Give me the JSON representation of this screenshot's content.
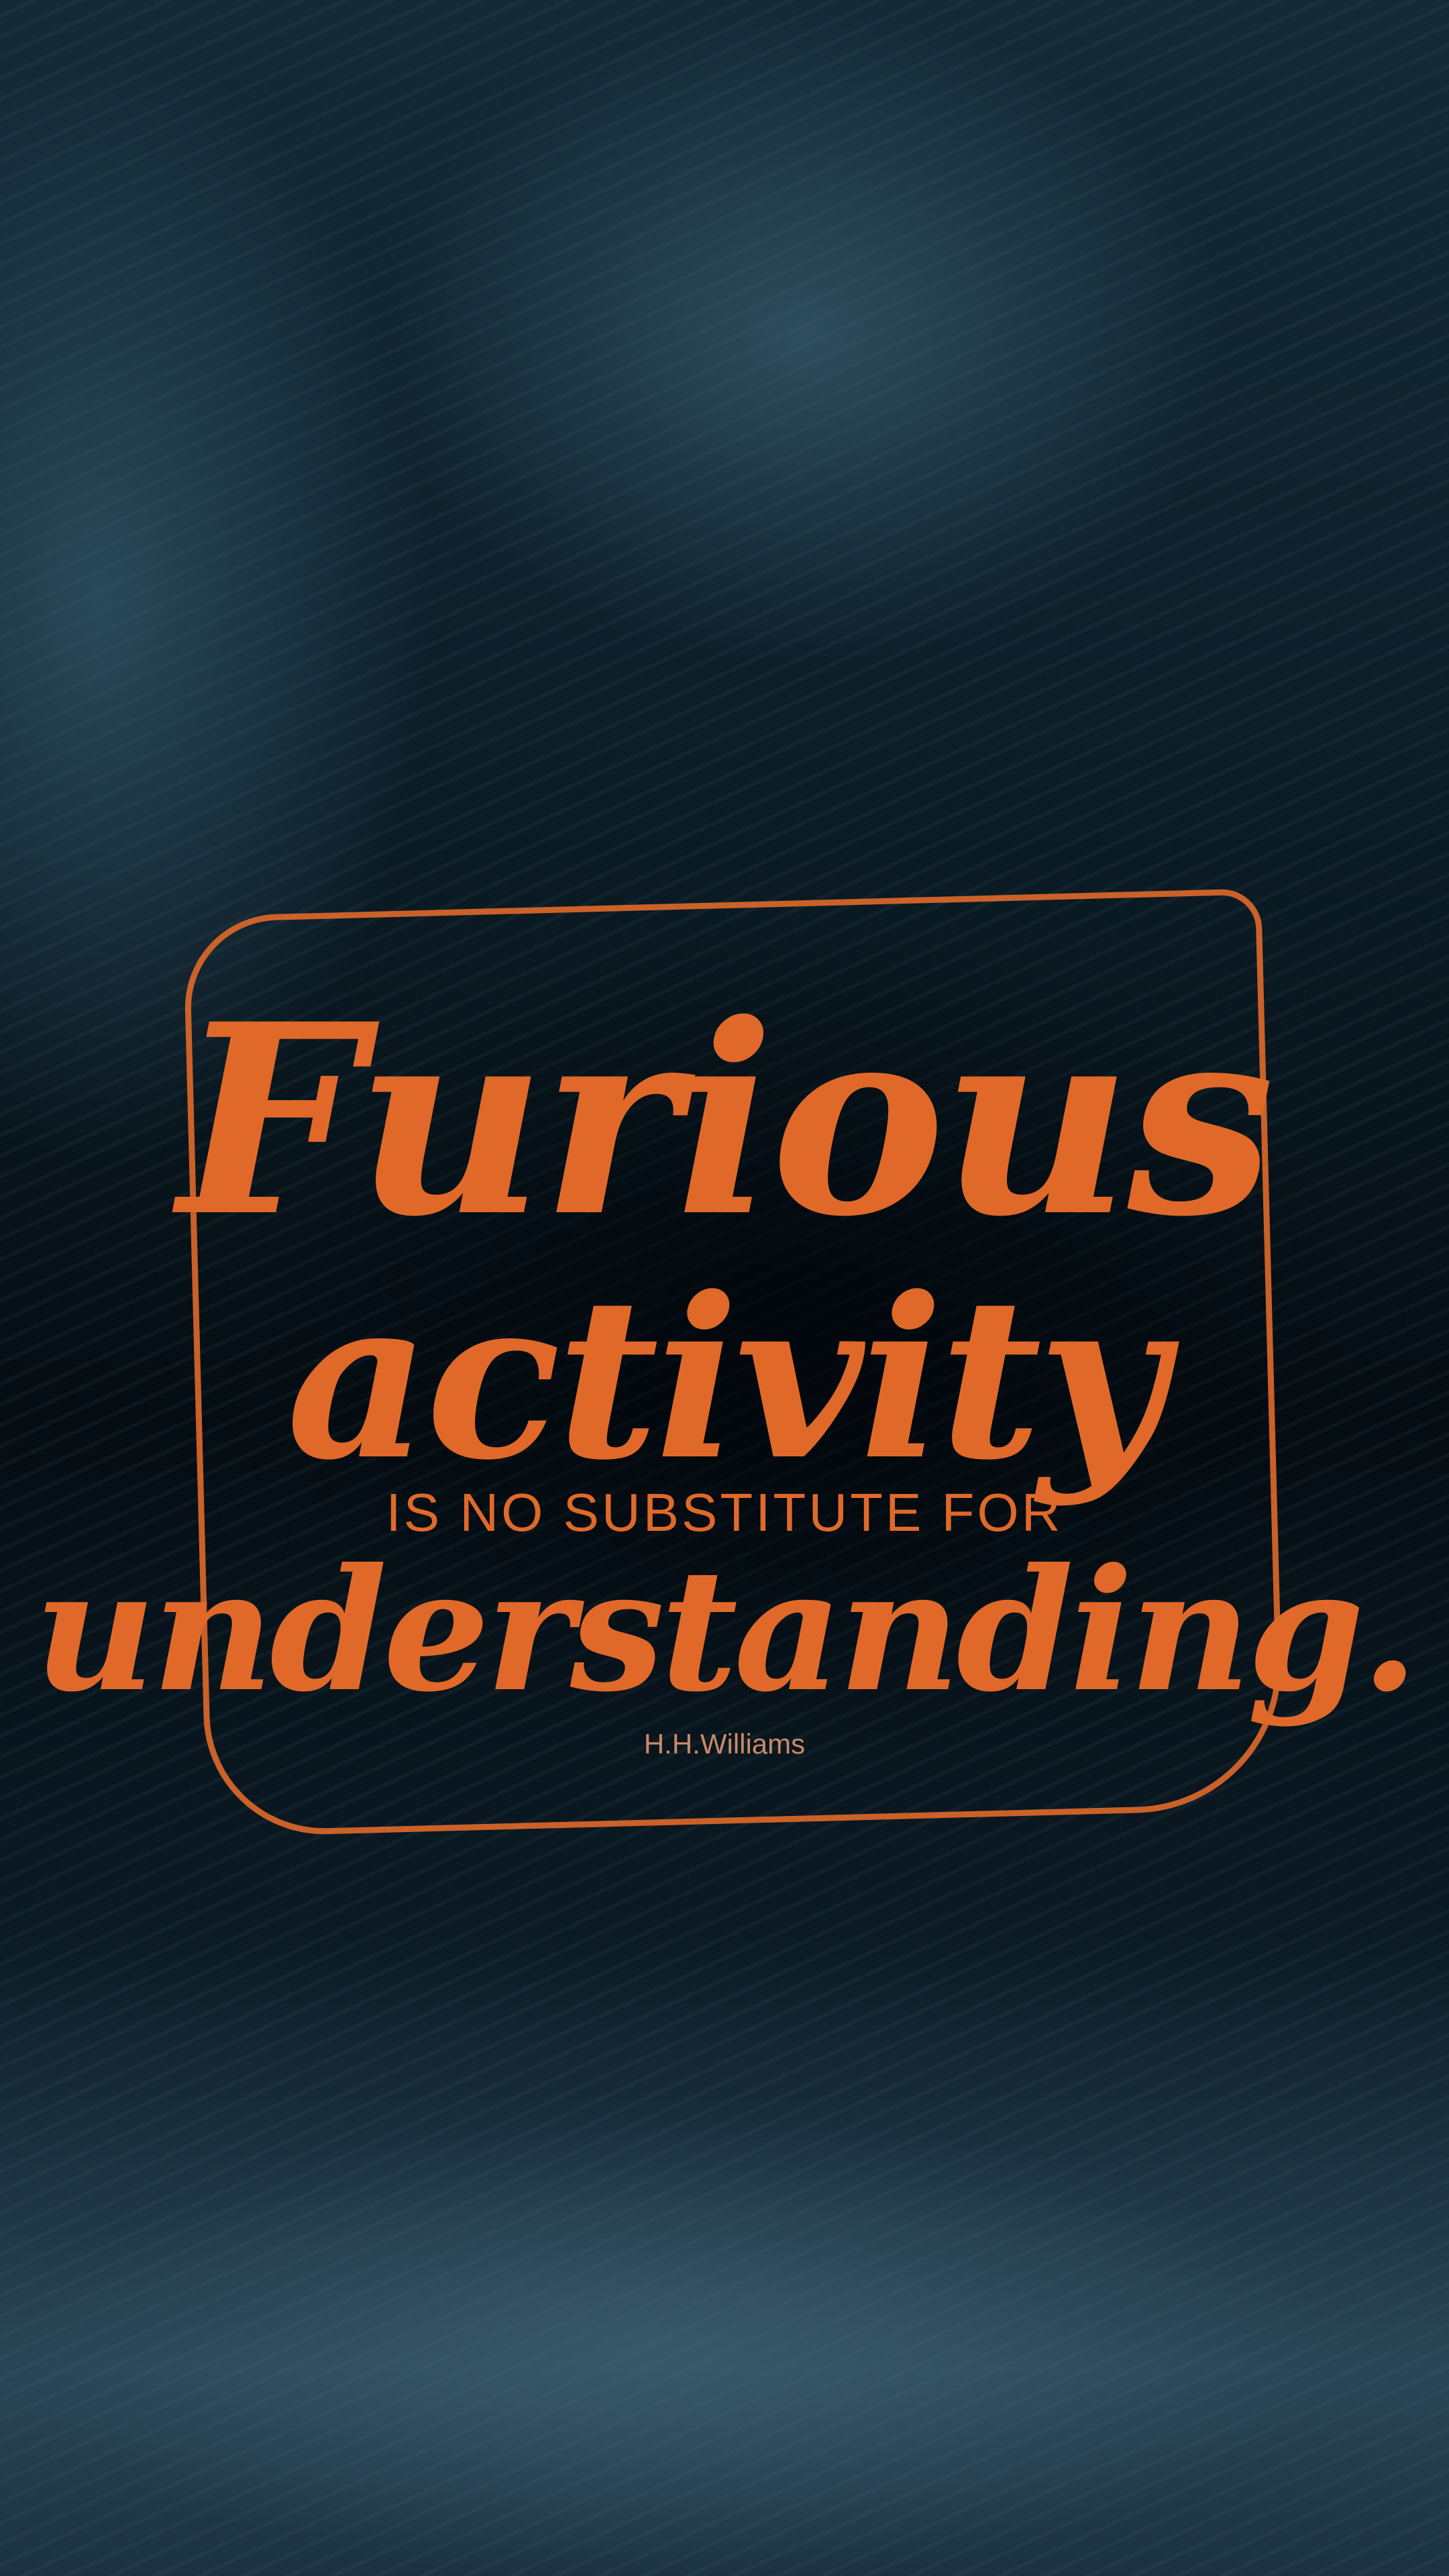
{
  "quote": {
    "line1": "Furious",
    "line2": "activity",
    "line3": "IS NO SUBSTITUTE FOR",
    "line4": "understanding.",
    "author": "H.H.Williams"
  },
  "colors": {
    "accent": "#e0692a",
    "background": "#0a1820"
  }
}
